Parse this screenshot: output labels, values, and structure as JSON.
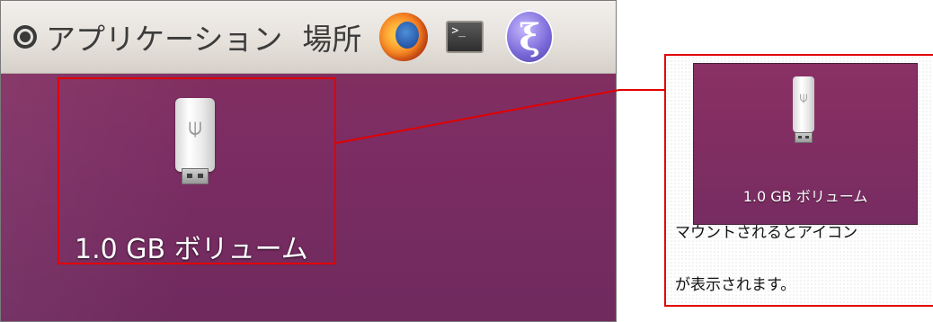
{
  "menubar": {
    "applications_label": "アプリケーション",
    "places_label": "場所",
    "launchers": [
      "firefox-icon",
      "terminal-icon",
      "emacs-icon"
    ]
  },
  "desktop": {
    "volume_label": "1.0 GB ボリューム",
    "volume_icon": "usb-drive-icon"
  },
  "callout": {
    "thumbnail_label": "1.0 GB ボリューム",
    "caption_line1": "マウントされるとアイコン",
    "caption_line2": "が表示されます。"
  },
  "colors": {
    "highlight": "#e10000",
    "desktop_purple": "#7c2d63",
    "panel": "#e5e0da"
  }
}
